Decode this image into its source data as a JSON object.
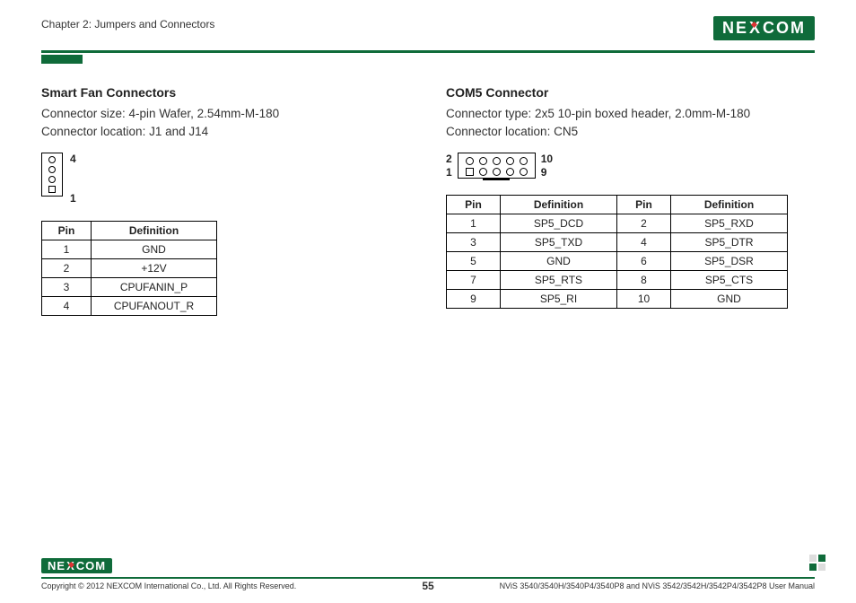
{
  "header": {
    "chapter": "Chapter 2: Jumpers and Connectors",
    "logo_text": "NE COM"
  },
  "left": {
    "title": "Smart Fan Connectors",
    "line1": "Connector size: 4-pin Wafer, 2.54mm-M-180",
    "line2": "Connector location: J1 and J14",
    "diag_top": "4",
    "diag_bot": "1",
    "th_pin": "Pin",
    "th_def": "Definition",
    "rows": [
      {
        "pin": "1",
        "def": "GND"
      },
      {
        "pin": "2",
        "def": "+12V"
      },
      {
        "pin": "3",
        "def": "CPUFANIN_P"
      },
      {
        "pin": "4",
        "def": "CPUFANOUT_R"
      }
    ]
  },
  "right": {
    "title": "COM5 Connector",
    "line1": "Connector type: 2x5 10-pin boxed header, 2.0mm-M-180",
    "line2": "Connector location: CN5",
    "dl2": "2",
    "dl1": "1",
    "dr10": "10",
    "dr9": "9",
    "th_pin": "Pin",
    "th_def": "Definition",
    "rows": [
      {
        "p1": "1",
        "d1": "SP5_DCD",
        "p2": "2",
        "d2": "SP5_RXD"
      },
      {
        "p1": "3",
        "d1": "SP5_TXD",
        "p2": "4",
        "d2": "SP5_DTR"
      },
      {
        "p1": "5",
        "d1": "GND",
        "p2": "6",
        "d2": "SP5_DSR"
      },
      {
        "p1": "7",
        "d1": "SP5_RTS",
        "p2": "8",
        "d2": "SP5_CTS"
      },
      {
        "p1": "9",
        "d1": "SP5_RI",
        "p2": "10",
        "d2": "GND"
      }
    ]
  },
  "footer": {
    "copyright": "Copyright © 2012 NEXCOM International Co., Ltd. All Rights Reserved.",
    "page": "55",
    "doc": "NViS 3540/3540H/3540P4/3540P8 and NViS 3542/3542H/3542P4/3542P8 User Manual"
  }
}
